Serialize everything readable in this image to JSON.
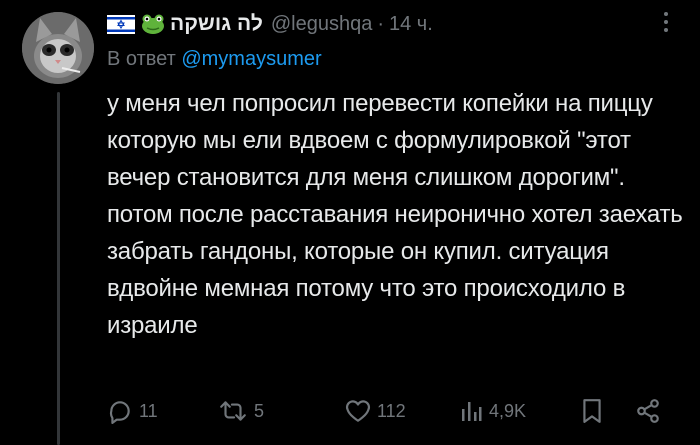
{
  "tweet": {
    "display_name": "לה גושקה",
    "handle": "@legushqa",
    "time": "14 ч.",
    "reply_prefix": "В ответ",
    "reply_mention": "@mymaysumer",
    "text": "у меня чел попросил перевести копейки на пиццу которую мы ели вдвоем с формулировкой \"этот вечер становится для меня слишком дорогим\". потом после расставания неиронично хотел заехать забрать гандоны, которые он купил. ситуация вдвойне мемная потому что это происходило в израиле"
  },
  "actions": {
    "replies": "11",
    "retweets": "5",
    "likes": "112",
    "views": "4,9K"
  },
  "icons": {
    "flag": "israel-flag-icon",
    "frog": "frog-emoji-icon",
    "reply": "reply-icon",
    "retweet": "retweet-icon",
    "like": "heart-icon",
    "views": "views-icon",
    "bookmark": "bookmark-icon",
    "share": "share-icon",
    "more": "more-icon"
  },
  "colors": {
    "background": "#000000",
    "text": "#e7e9ea",
    "secondary": "#71767b",
    "mention": "#1d9bf0"
  }
}
